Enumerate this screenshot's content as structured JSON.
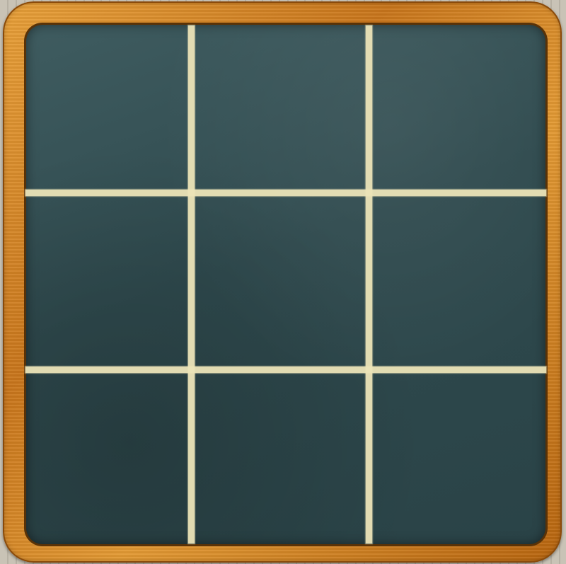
{
  "game": "tic-tac-toe",
  "board": {
    "size": 3,
    "cells": [
      "",
      "",
      "",
      "",
      "",
      "",
      "",
      "",
      ""
    ]
  },
  "colors": {
    "chalk": "#ece4b8",
    "chalkboard": "#2f4a4e",
    "frame_wood": "#d8892a",
    "background": "#c9c3b6"
  }
}
